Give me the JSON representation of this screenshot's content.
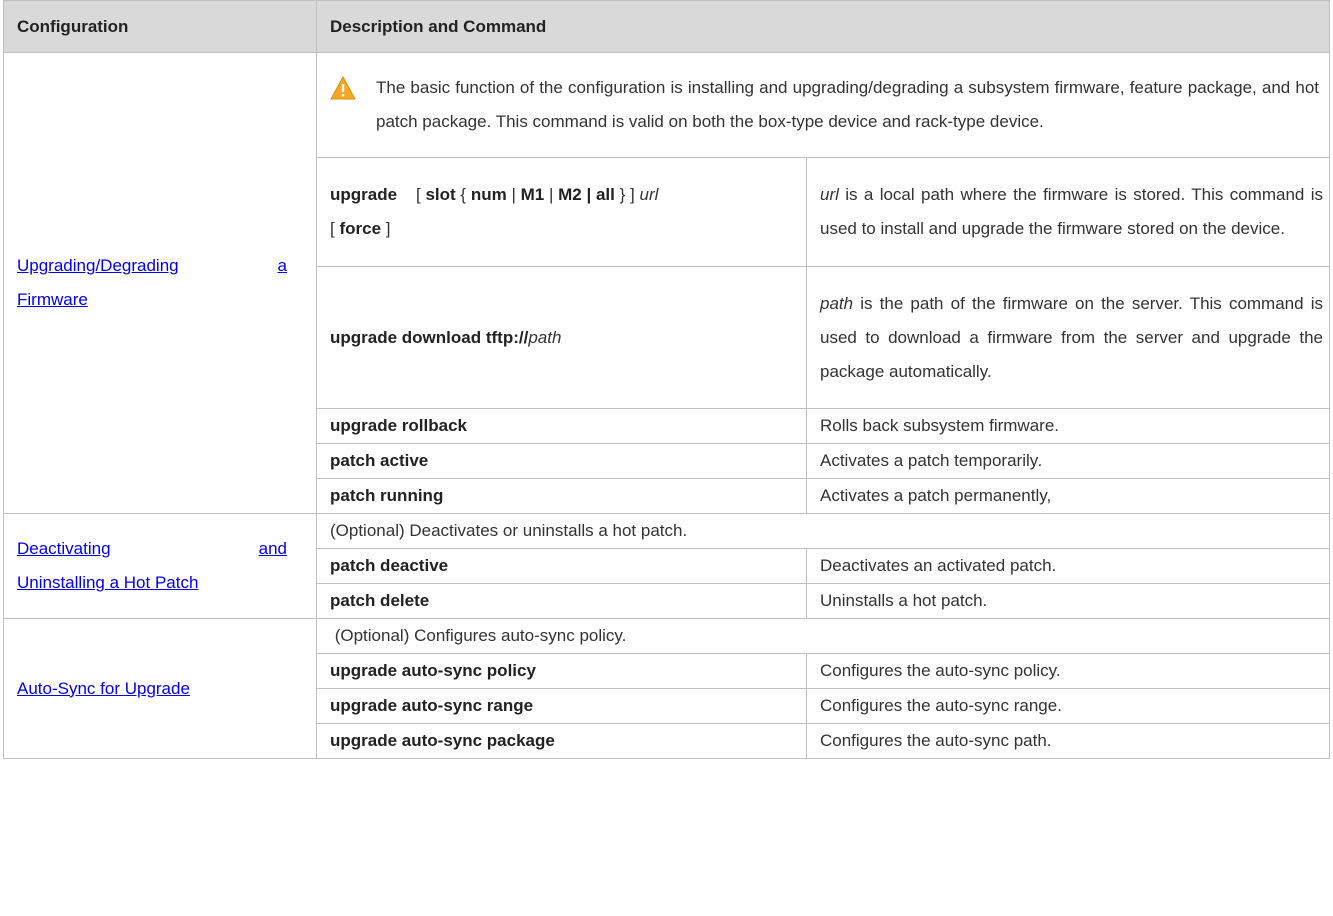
{
  "headers": {
    "configuration": "Configuration",
    "description": "Description and Command"
  },
  "sections": {
    "firmware": {
      "link_line1": "Upgrading/Degrading",
      "link_a": "a",
      "link_line2": "Firmware",
      "note": "The basic function of the configuration is installing and upgrading/degrading a subsystem firmware, feature package, and hot patch package. This command is valid on both the box-type device and rack-type device.",
      "note_icon": "warning-icon",
      "rows": {
        "upgrade": {
          "cmd": "upgrade",
          "bracket_open": "[",
          "slot": "slot",
          "brace_open": "{",
          "num": "num",
          "pipe1": "|",
          "m1": "M1",
          "pipe2": "|",
          "m2_all": "M2 | all",
          "brace_close": "}",
          "bracket_close": "]",
          "url": "url",
          "force_open": "[",
          "force": "force",
          "force_close": "]",
          "desc_italic": "url",
          "desc": " is a local path where the firmware is stored. This command is used to install and upgrade the firmware stored on the device."
        },
        "download": {
          "cmd": "upgrade download tftp://",
          "arg": "path",
          "desc_italic": "path",
          "desc": " is the path of the firmware on the server. This command is used to download a firmware from the server and upgrade the package automatically."
        },
        "rollback": {
          "cmd": "upgrade rollback",
          "desc": "Rolls back subsystem firmware."
        },
        "active": {
          "cmd": "patch active",
          "desc": "Activates a patch temporarily",
          "desc_italic_end": "."
        },
        "running": {
          "cmd": "patch running",
          "desc": "Activates a patch permanently,"
        }
      }
    },
    "hotpatch": {
      "link_word1": "Deactivating",
      "link_word2": "and",
      "link_line2": "Uninstalling a Hot Patch",
      "optional": "(Optional) Deactivates or uninstalls a hot patch.",
      "rows": {
        "deactive": {
          "cmd": "patch deactive",
          "desc": "Deactivates an activated patch."
        },
        "delete": {
          "cmd": "patch delete",
          "desc": "Uninstalls a hot patch."
        }
      }
    },
    "autosync": {
      "link": "Auto-Sync for Upgrade",
      "optional": " (Optional) Configures auto-sync policy.",
      "rows": {
        "policy": {
          "cmd": "upgrade auto-sync policy",
          "desc": "Configures the auto-sync policy."
        },
        "range": {
          "cmd": "upgrade auto-sync range",
          "desc": "Configures the auto-sync range."
        },
        "package": {
          "cmd": "upgrade auto-sync package",
          "desc": "Configures the auto-sync path."
        }
      }
    }
  },
  "colors": {
    "header_bg": "#d9d9d9",
    "link": "#0000ee",
    "warning": "#f5a623"
  }
}
